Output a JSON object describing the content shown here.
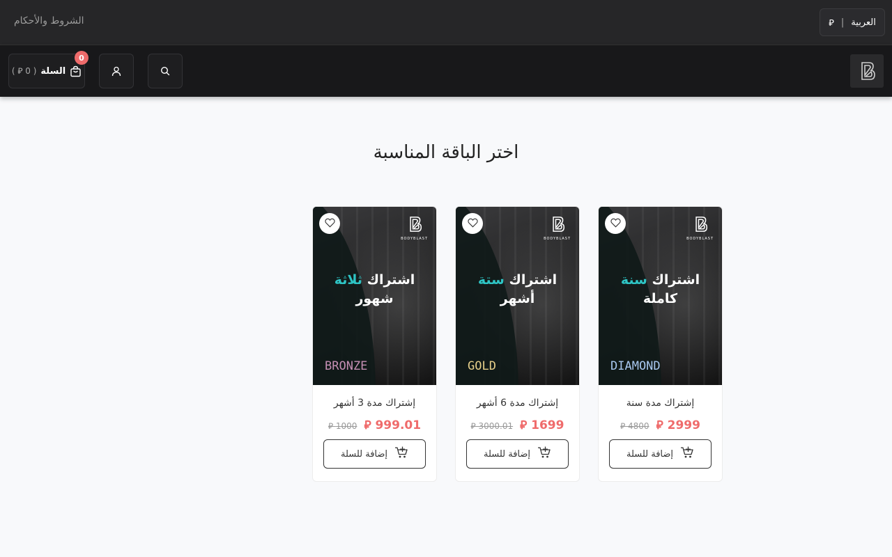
{
  "topbar": {
    "language_label": "العربية",
    "currency_symbol": "⃁",
    "terms_link": "الشروط والأحكام"
  },
  "header": {
    "logo_icon": "bodyblast-logo",
    "search_icon": "search-icon",
    "account_icon": "user-icon",
    "cart": {
      "label": "السلة",
      "total": "( 0 ⃁ )",
      "count": "0"
    }
  },
  "main": {
    "title": "اختر الباقة المناسبة",
    "products": [
      {
        "image_title_prefix": "اشتراك",
        "image_title_accent": "سنة",
        "image_title_suffix": "كاملة",
        "brand": "BODYBLAST",
        "tier": "DIAMOND",
        "tier_color": "#a9c8f0",
        "name": "إشتراك مدة سنة",
        "price": "2999 ⃁",
        "old_price": "4800 ⃁",
        "add_label": "إضافة للسلة"
      },
      {
        "image_title_prefix": "اشتراك",
        "image_title_accent": "ستة",
        "image_title_suffix": "أشهر",
        "brand": "BODYBLAST",
        "tier": "GOLD",
        "tier_color": "#e6cf8a",
        "name": "إشتراك مدة 6 أشهر",
        "price": "1699 ⃁",
        "old_price": "3000.01 ⃁",
        "add_label": "إضافة للسلة"
      },
      {
        "image_title_prefix": "اشتراك",
        "image_title_accent": "ثلاثة",
        "image_title_suffix": "شهور",
        "brand": "BODYBLAST",
        "tier": "BRONZE",
        "tier_color": "#c58fb4",
        "name": "إشتراك مدة 3 أشهر",
        "price": "999.01 ⃁",
        "old_price": "1000 ⃁",
        "add_label": "إضافة للسلة"
      }
    ]
  }
}
